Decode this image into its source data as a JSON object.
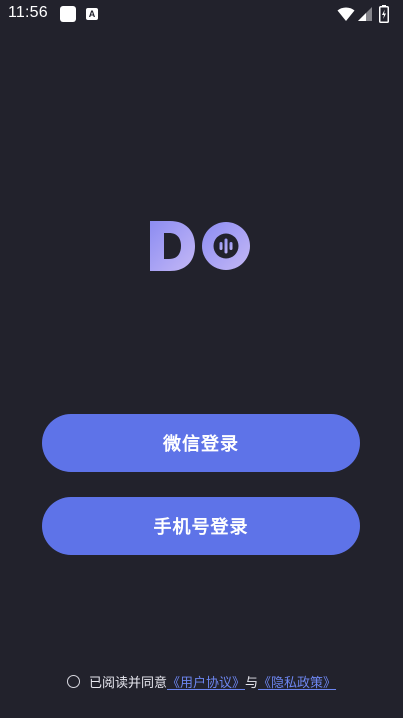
{
  "status_bar": {
    "time": "11:56",
    "notification_a": "A"
  },
  "logo": {
    "text": "DO"
  },
  "buttons": {
    "wechat_login": "微信登录",
    "phone_login": "手机号登录"
  },
  "agreement": {
    "prefix": "已阅读并同意",
    "user_agreement": "《用户协议》",
    "conjunction": "与",
    "privacy_policy": "《隐私政策》"
  },
  "colors": {
    "background": "#22222c",
    "accent": "#5e73e8",
    "link": "#6d86f0",
    "logo_gradient_start": "#8c8cf2",
    "logo_gradient_end": "#c4b8f5"
  }
}
